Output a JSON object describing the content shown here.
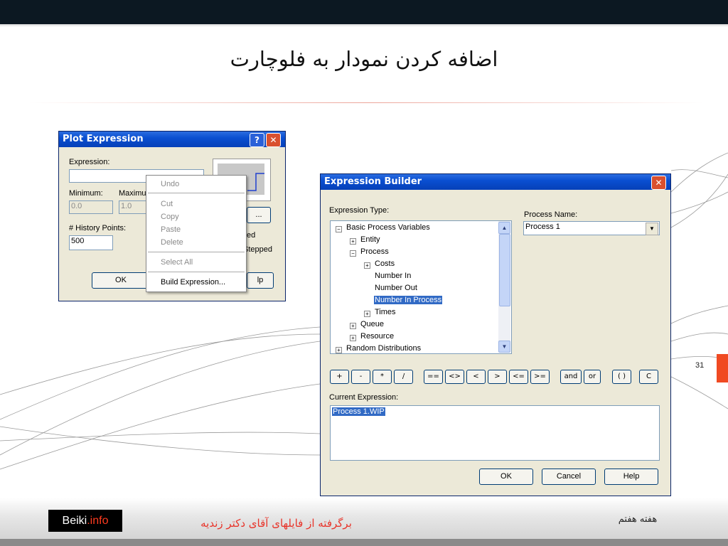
{
  "slide": {
    "title": "اضافه کردن نمودار به فلوچارت",
    "page_number": "31",
    "footer_source": "برگرفته از فایلهای آقای دکتر زندیه",
    "footer_week": "هفته هفتم",
    "logo_main": "Beiki",
    "logo_accent": ".info"
  },
  "plot_dialog": {
    "title": "Plot Expression",
    "expression_label": "Expression:",
    "expression_value": "",
    "minimum_label": "Minimum:",
    "minimum_value": "0.0",
    "maximum_label": "Maximu",
    "maximum_value": "1.0",
    "history_label": "# History Points:",
    "history_value": "500",
    "partial_button": "...",
    "partial_text_1": "ed",
    "partial_text_2": "Stepped",
    "ok": "OK",
    "help_partial": "lp"
  },
  "context_menu": {
    "items": [
      "Undo",
      "Cut",
      "Copy",
      "Paste",
      "Delete",
      "Select All",
      "Build Expression..."
    ]
  },
  "expression_builder": {
    "title": "Expression Builder",
    "expression_type_label": "Expression Type:",
    "process_name_label": "Process Name:",
    "process_name_value": "Process 1",
    "tree": [
      {
        "label": "Basic Process Variables",
        "toggle": "−"
      },
      {
        "label": "Entity",
        "toggle": "+"
      },
      {
        "label": "Process",
        "toggle": "−"
      },
      {
        "label": "Costs",
        "toggle": "+"
      },
      {
        "label": "Number In",
        "toggle": ""
      },
      {
        "label": "Number Out",
        "toggle": ""
      },
      {
        "label": "Number In Process",
        "toggle": ""
      },
      {
        "label": "Times",
        "toggle": "+"
      },
      {
        "label": "Queue",
        "toggle": "+"
      },
      {
        "label": "Resource",
        "toggle": "+"
      },
      {
        "label": "Random Distributions",
        "toggle": "+"
      }
    ],
    "selected_node": "Number In Process",
    "operators": [
      "+",
      "-",
      "*",
      "/",
      "==",
      "<>",
      "<",
      ">",
      "<=",
      ">=",
      "and",
      "or",
      "( )",
      "C"
    ],
    "current_expression_label": "Current Expression:",
    "current_expression_value": "Process 1.WIP",
    "ok": "OK",
    "cancel": "Cancel",
    "help": "Help"
  }
}
